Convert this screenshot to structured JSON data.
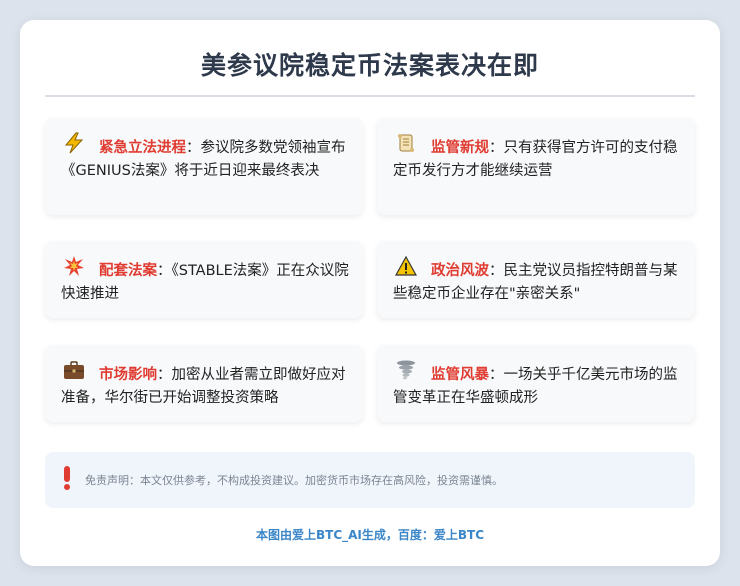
{
  "title": "美参议院稳定币法案表决在即",
  "items": [
    {
      "icon": "lightning-icon",
      "glyph": "⚡",
      "heading": "紧急立法进程",
      "text": "：参议院多数党领袖宣布《GENIUS法案》将于近日迎来最终表决"
    },
    {
      "icon": "scroll-icon",
      "glyph": "📜",
      "heading": "监管新规",
      "text": "：只有获得官方许可的支付稳定币发行方才能继续运营"
    },
    {
      "icon": "collision-icon",
      "glyph": "💥",
      "heading": "配套法案",
      "text": "：《STABLE法案》正在众议院快速推进"
    },
    {
      "icon": "warning-icon",
      "glyph": "⚠",
      "heading": "政治风波",
      "text": "：民主党议员指控特朗普与某些稳定币企业存在\"亲密关系\""
    },
    {
      "icon": "briefcase-icon",
      "glyph": "💼",
      "heading": "市场影响",
      "text": "：加密从业者需立即做好应对准备，华尔街已开始调整投资策略"
    },
    {
      "icon": "tornado-icon",
      "glyph": "🌪",
      "heading": "监管风暴",
      "text": "：一场关乎千亿美元市场的监管变革正在华盛顿成形"
    }
  ],
  "disclaimer": {
    "icon": "exclamation-icon",
    "text": "免责声明：本文仅供参考，不构成投资建议。加密货币市场存在高风险，投资需谨慎。"
  },
  "credit": "本图由爱上BTC_AI生成，百度：爱上BTC",
  "colors": {
    "accent": "#e03c31",
    "title": "#2e3a4c",
    "credit": "#3a86c8",
    "background": "#dde3ec"
  }
}
